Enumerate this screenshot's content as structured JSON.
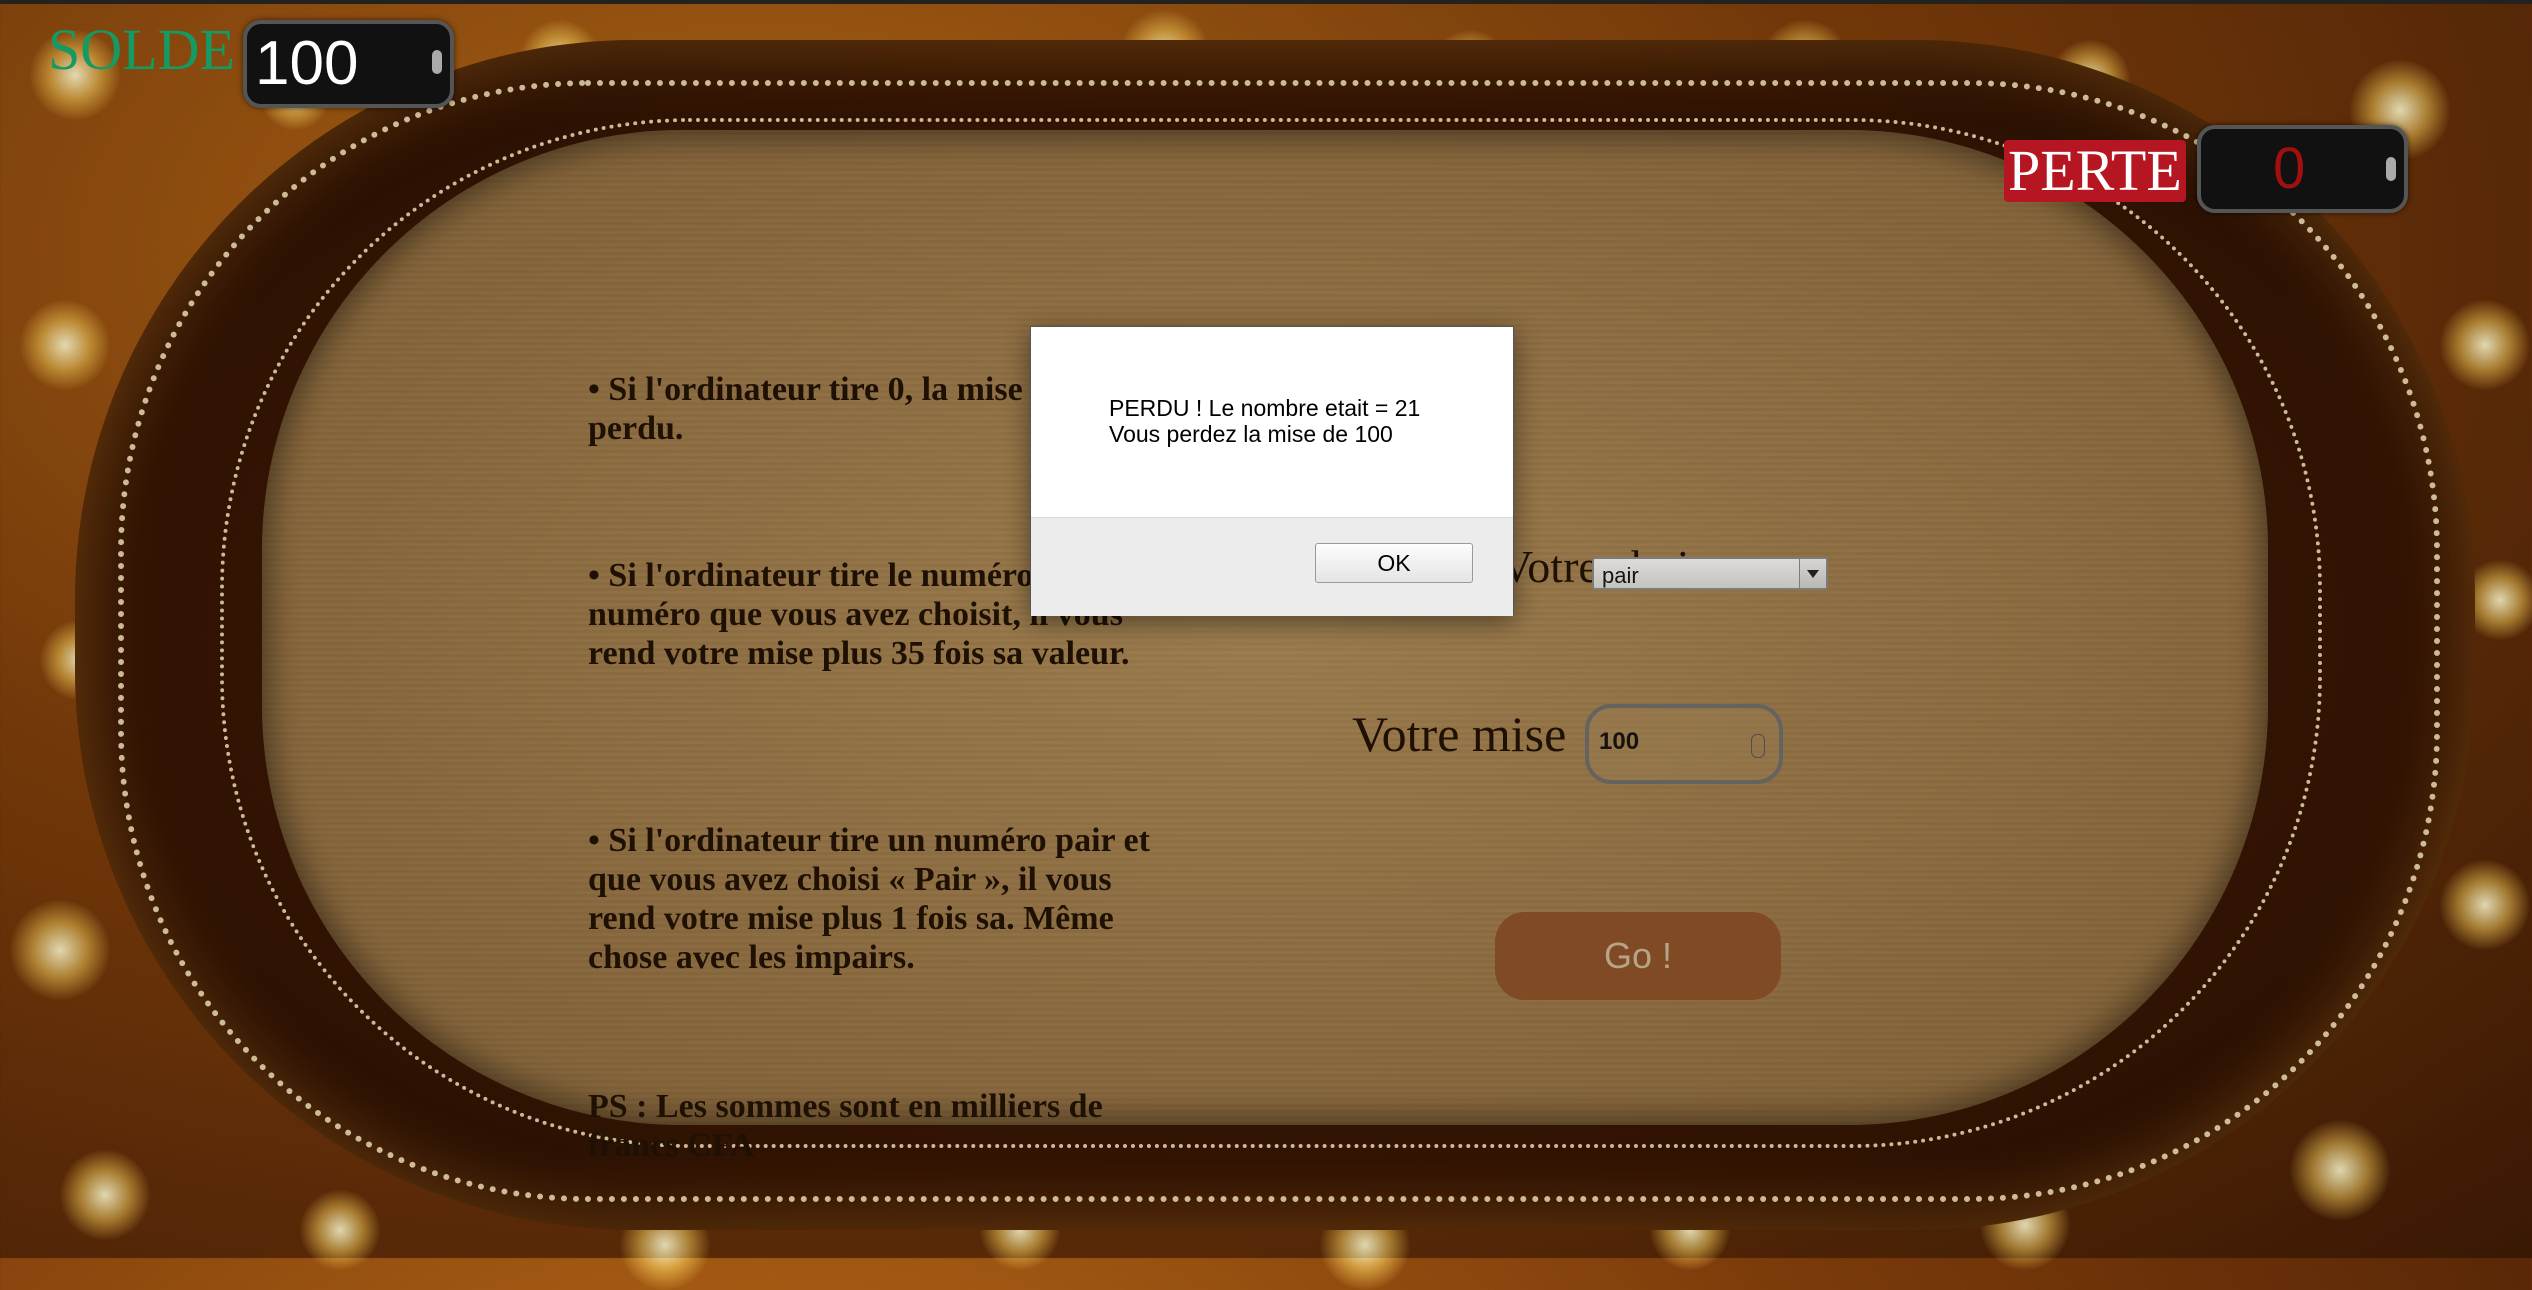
{
  "balance": {
    "label": "SOLDE",
    "value": "100"
  },
  "loss": {
    "label": "PERTE",
    "value": "0"
  },
  "rules": [
    "• Si l'ordinateur tire 0, la mise est perdu.",
    "• Si l'ordinateur tire le numéro le numéro que vous avez choisit, il vous rend votre mise plus 35 fois sa valeur.",
    "• Si l'ordinateur tire un numéro pair et que vous avez choisi « Pair », il vous rend votre mise plus 1 fois sa. Même chose avec les impairs.",
    "PS : Les sommes sont en milliers de francs CFA"
  ],
  "choice": {
    "label": "Votre choix",
    "selected": "pair"
  },
  "bet": {
    "label": "Votre mise",
    "value": "100"
  },
  "go_button": "Go !",
  "alert": {
    "line1": "PERDU ! Le nombre etait = 21",
    "line2": "Vous perdez la mise de 100",
    "ok": "OK"
  }
}
